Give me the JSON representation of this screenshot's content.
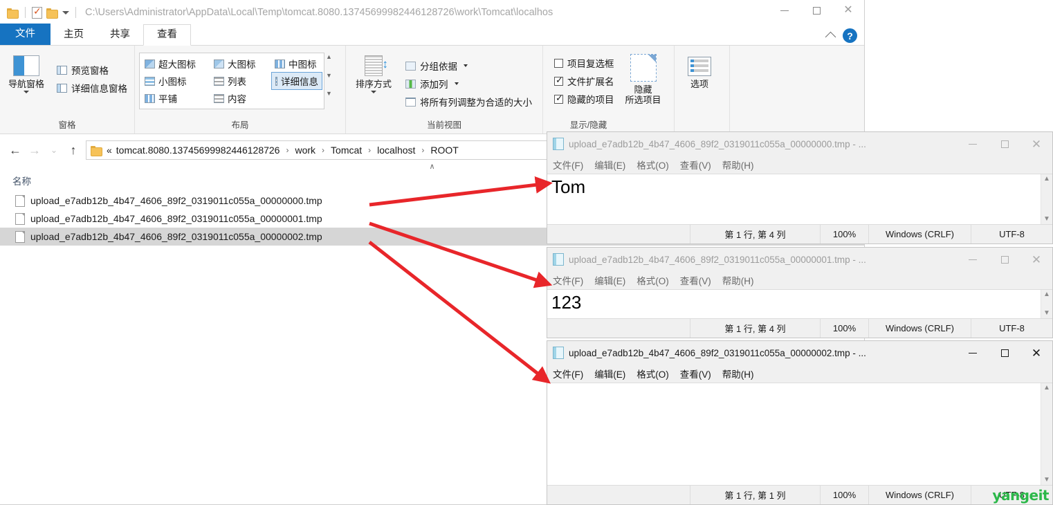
{
  "explorer": {
    "title_path": "C:\\Users\\Administrator\\AppData\\Local\\Temp\\tomcat.8080.13745699982446128726\\work\\Tomcat\\localhos",
    "quick_access": [
      {
        "name": "folder-icon"
      },
      {
        "name": "properties-icon"
      },
      {
        "name": "new-folder-icon"
      },
      {
        "name": "customize-dropdown-icon"
      }
    ],
    "window_controls": {
      "minimize": "—",
      "maximize": "□",
      "close": "✕"
    },
    "tabs": [
      {
        "label": "文件",
        "kind": "file"
      },
      {
        "label": "主页",
        "kind": "normal"
      },
      {
        "label": "共享",
        "kind": "normal"
      },
      {
        "label": "查看",
        "kind": "active"
      }
    ],
    "help_label": "?",
    "ribbon": {
      "groups": [
        {
          "label": "窗格",
          "big_button": "导航窗格",
          "items": [
            "预览窗格",
            "详细信息窗格"
          ]
        },
        {
          "label": "布局",
          "views": [
            {
              "label": "超大图标",
              "selected": false
            },
            {
              "label": "大图标",
              "selected": false
            },
            {
              "label": "中图标",
              "selected": false
            },
            {
              "label": "小图标",
              "selected": false
            },
            {
              "label": "列表",
              "selected": false
            },
            {
              "label": "详细信息",
              "selected": true
            },
            {
              "label": "平铺",
              "selected": false
            },
            {
              "label": "内容",
              "selected": false
            }
          ]
        },
        {
          "label": "当前视图",
          "big_button": "排序方式",
          "items": [
            "分组依据",
            "添加列",
            "将所有列调整为合适的大小"
          ]
        },
        {
          "label": "显示/隐藏",
          "checkboxes": [
            {
              "label": "项目复选框",
              "checked": false
            },
            {
              "label": "文件扩展名",
              "checked": true
            },
            {
              "label": "隐藏的项目",
              "checked": true
            }
          ],
          "hide_button_line1": "隐藏",
          "hide_button_line2": "所选项目"
        },
        {
          "label": "",
          "options_button": "选项"
        }
      ]
    },
    "address": {
      "back": "←",
      "forward": "→",
      "recent": "⌄",
      "up": "↑",
      "overflow": "«",
      "crumbs": [
        "tomcat.8080.13745699982446128726",
        "work",
        "Tomcat",
        "localhost",
        "ROOT"
      ],
      "separator": "›",
      "expand_chevron": "∧"
    },
    "column_header": "名称",
    "files": [
      {
        "name": "upload_e7adb12b_4b47_4606_89f2_0319011c055a_00000000.tmp",
        "selected": false
      },
      {
        "name": "upload_e7adb12b_4b47_4606_89f2_0319011c055a_00000001.tmp",
        "selected": false
      },
      {
        "name": "upload_e7adb12b_4b47_4606_89f2_0319011c055a_00000002.tmp",
        "selected": true
      }
    ]
  },
  "notepads": [
    {
      "title": "upload_e7adb12b_4b47_4606_89f2_0319011c055a_00000000.tmp - ...",
      "active": false,
      "menu": [
        "文件(F)",
        "编辑(E)",
        "格式(O)",
        "查看(V)",
        "帮助(H)"
      ],
      "content": "Tom",
      "status": {
        "position": "第 1 行, 第 4 列",
        "zoom": "100%",
        "eol": "Windows (CRLF)",
        "encoding": "UTF-8"
      }
    },
    {
      "title": "upload_e7adb12b_4b47_4606_89f2_0319011c055a_00000001.tmp - ...",
      "active": false,
      "menu": [
        "文件(F)",
        "编辑(E)",
        "格式(O)",
        "查看(V)",
        "帮助(H)"
      ],
      "content": "123",
      "status": {
        "position": "第 1 行, 第 4 列",
        "zoom": "100%",
        "eol": "Windows (CRLF)",
        "encoding": "UTF-8"
      }
    },
    {
      "title": "upload_e7adb12b_4b47_4606_89f2_0319011c055a_00000002.tmp - ...",
      "active": true,
      "menu": [
        "文件(F)",
        "编辑(E)",
        "格式(O)",
        "查看(V)",
        "帮助(H)"
      ],
      "content": "",
      "status": {
        "position": "第 1 行, 第 1 列",
        "zoom": "100%",
        "eol": "Windows (CRLF)",
        "encoding": "UTF-8"
      }
    }
  ],
  "annotations": {
    "arrow_color": "#e8262a",
    "arrow_count": 3
  },
  "watermark": {
    "text": "yangeit",
    "color": "#2cb84a"
  }
}
